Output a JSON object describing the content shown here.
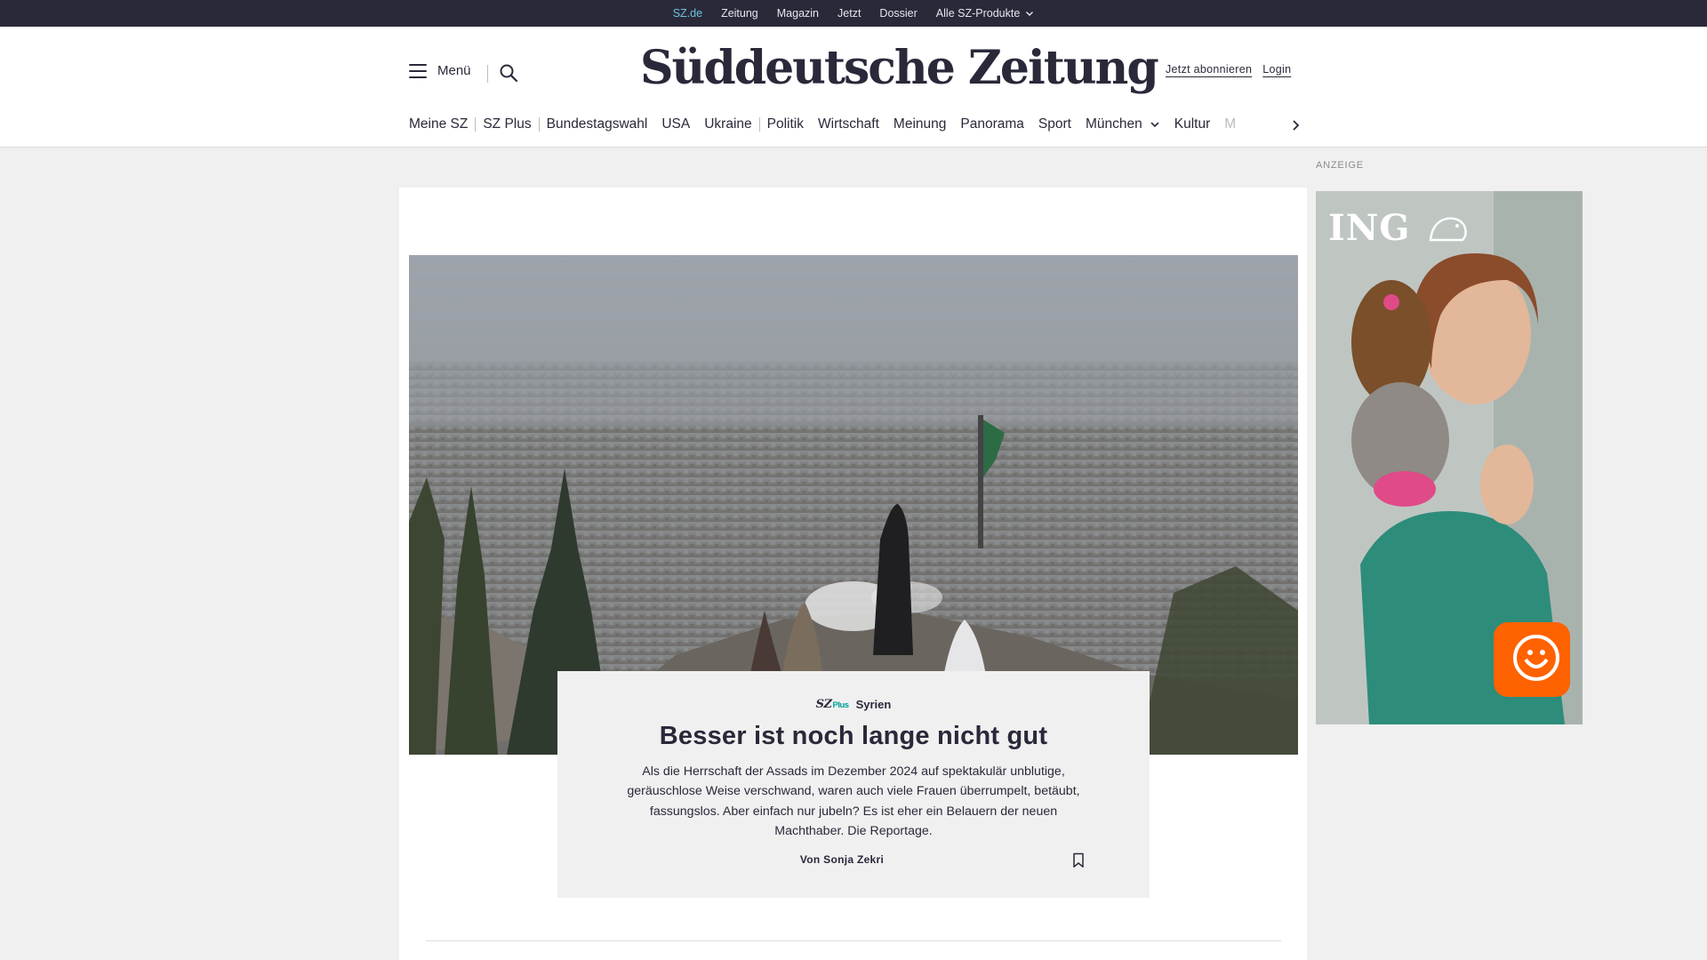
{
  "topbar": {
    "links": [
      "SZ.de",
      "Zeitung",
      "Magazin",
      "Jetzt",
      "Dossier",
      "Alle SZ-Produkte"
    ]
  },
  "header": {
    "menu_label": "Menü",
    "logo": "Süddeutsche Zeitung",
    "subscribe": "Jetzt abonnieren",
    "login": "Login"
  },
  "nav": {
    "items": [
      "Meine SZ",
      "SZ Plus",
      "Bundestagswahl",
      "USA",
      "Ukraine",
      "Politik",
      "Wirtschaft",
      "Meinung",
      "Panorama",
      "Sport",
      "München",
      "Kultur",
      "M"
    ]
  },
  "teaser": {
    "badge": "SZ",
    "badge_plus": "Plus",
    "kicker": "Syrien",
    "headline": "Besser ist noch lange nicht gut",
    "summary": "Als die Herrschaft der Assads im Dezember 2024 auf spektakulär unblutige, geräuschlose Weise verschwand, waren auch viele Frauen überrumpelt, betäubt, fassungslos. Aber einfach nur jubeln? Es ist eher ein Belauern der neuen Machthaber. Die Reportage.",
    "byline": "Von Sonja Zekri"
  },
  "ad": {
    "label": "ANZEIGE",
    "brand": "ING"
  },
  "colors": {
    "dark": "#29293a",
    "accent_cyan": "#71c5d9",
    "sz_plus_green": "#00a096",
    "ing_orange": "#ff6200",
    "page_bg": "#f0f0f0"
  }
}
